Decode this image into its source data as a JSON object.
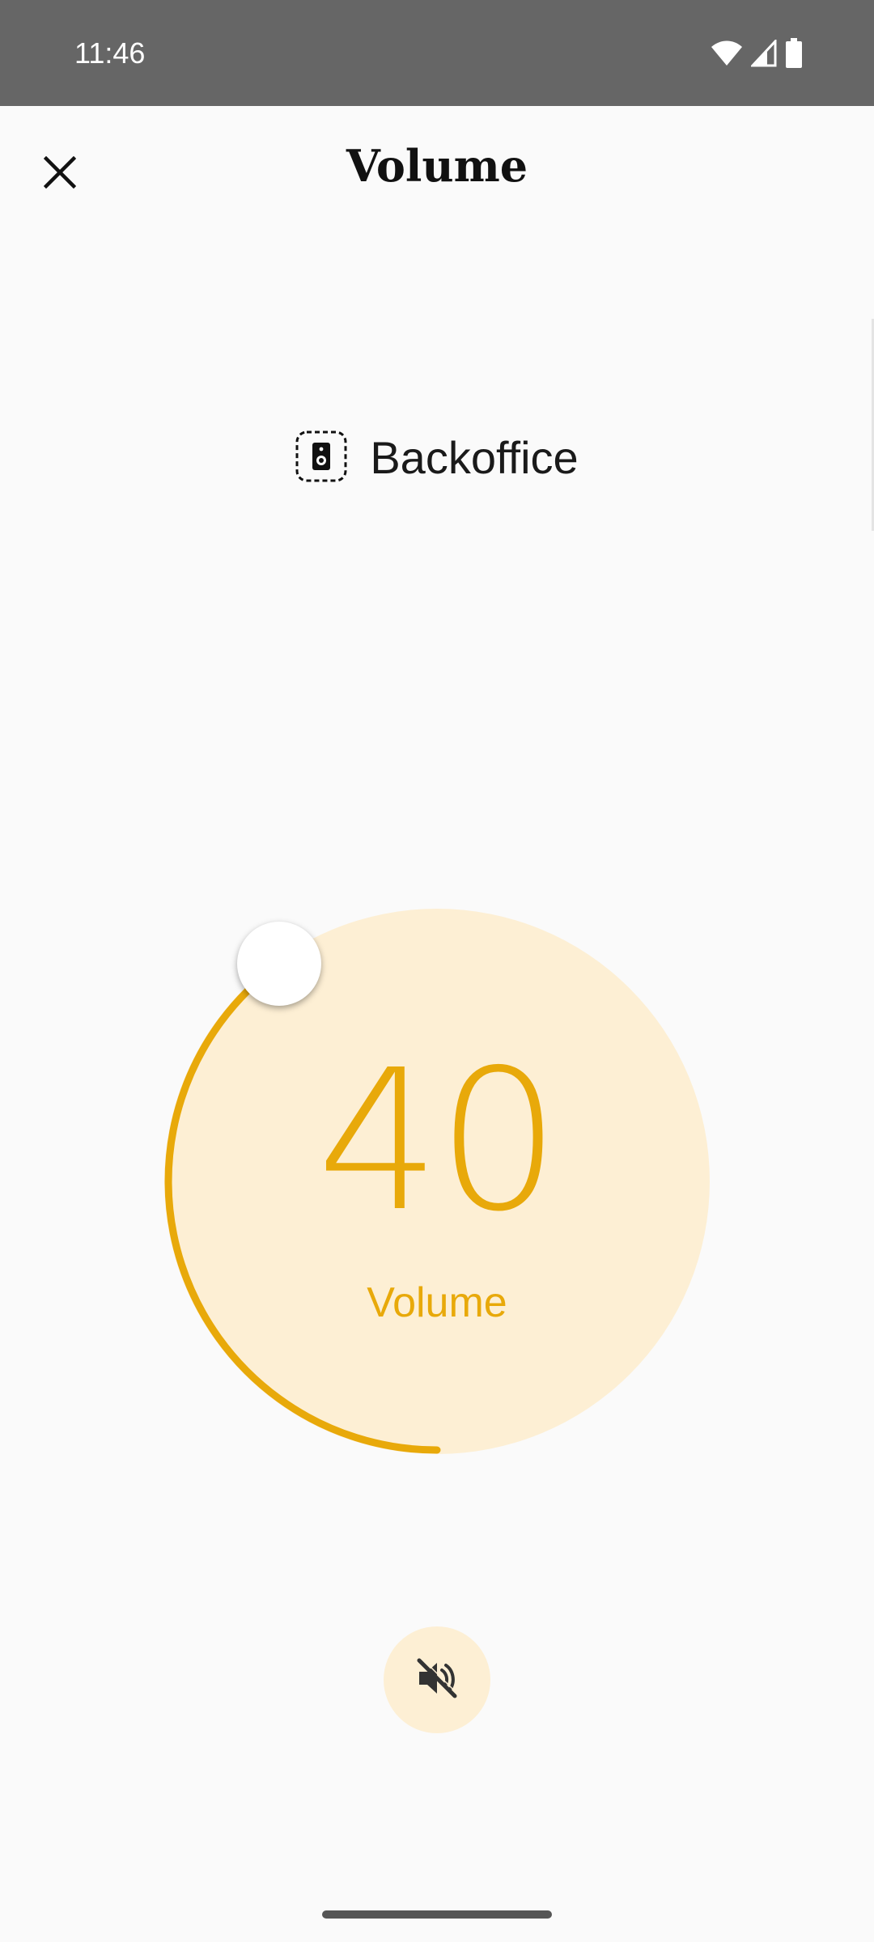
{
  "status_bar": {
    "time": "11:46",
    "icons": [
      "wifi-icon",
      "cellular-signal-icon",
      "battery-icon"
    ]
  },
  "header": {
    "title": "Volume",
    "close_icon": "close-icon"
  },
  "device": {
    "icon": "speaker-icon",
    "name": "Backoffice"
  },
  "volume": {
    "value": "40",
    "label": "Volume",
    "level_fraction": 0.4
  },
  "mute": {
    "icon": "volume-off-icon"
  },
  "colors": {
    "accent": "#e8a90a",
    "dial_fill": "#fdefd4",
    "background": "#fafafa",
    "status_bar": "#666666"
  }
}
